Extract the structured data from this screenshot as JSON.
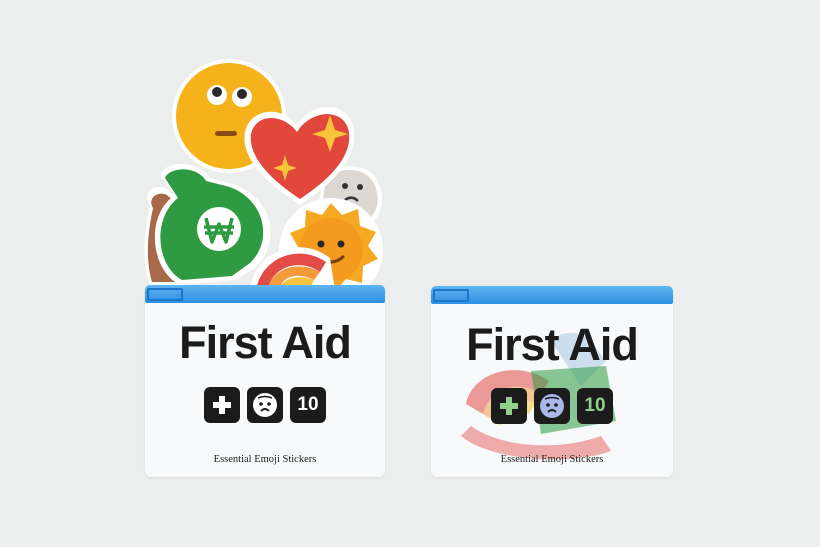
{
  "scene": {
    "background": "#eceded",
    "zipper_color": "#2f8fe0"
  },
  "pouches": [
    {
      "title": "First Aid",
      "icons": [
        "plus-icon",
        "sad-face-icon"
      ],
      "count_label": "10",
      "tagline": "Essential Emoji Stickers"
    },
    {
      "title": "First Aid",
      "icons": [
        "plus-icon",
        "sad-face-icon"
      ],
      "count_label": "10",
      "tagline": "Essential Emoji Stickers"
    }
  ],
  "stickers": [
    {
      "name": "rolling-eyes-face",
      "color": "#f6b21b"
    },
    {
      "name": "sparkling-heart",
      "color": "#e2473c"
    },
    {
      "name": "money-bag-won",
      "color": "#2e9a41"
    },
    {
      "name": "smiling-sun",
      "color": "#f7a823"
    },
    {
      "name": "ghost-face",
      "color": "#ddd9d2"
    },
    {
      "name": "rainbow",
      "color": "#f08a3c"
    },
    {
      "name": "brown-blob",
      "color": "#a8684a"
    }
  ]
}
